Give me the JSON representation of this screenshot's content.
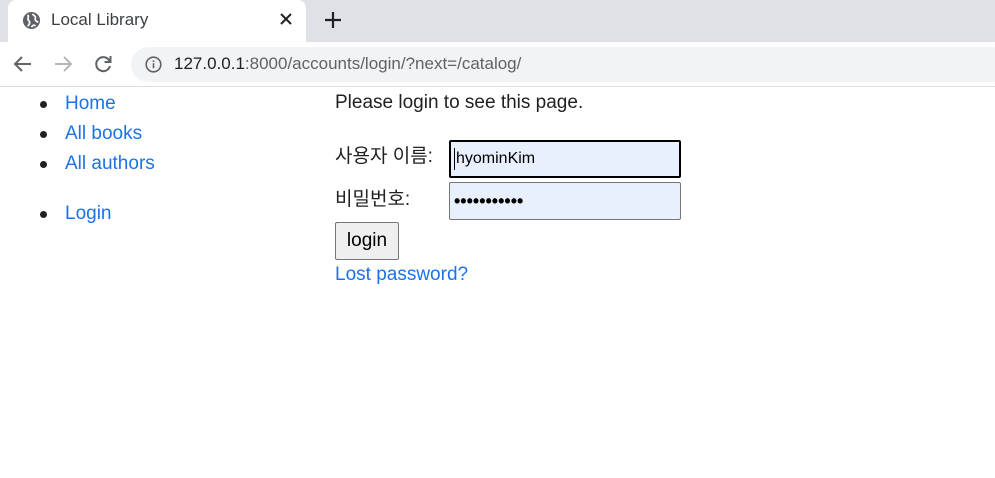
{
  "browser": {
    "tab_title": "Local Library",
    "url_host": "127.0.0.1",
    "url_path": ":8000/accounts/login/?next=/catalog/",
    "icons": {
      "favicon": "globe-icon",
      "close": "close-icon",
      "new_tab": "plus-icon",
      "back": "back-arrow-icon",
      "forward": "forward-arrow-icon",
      "reload": "reload-icon",
      "site_info": "info-icon"
    }
  },
  "sidebar": {
    "nav_links": [
      "Home",
      "All books",
      "All authors"
    ],
    "account_links": [
      "Login"
    ]
  },
  "login": {
    "notice": "Please login to see this page.",
    "username_label": "사용자 이름:",
    "username_value": "hyominKim",
    "password_label": "비밀번호:",
    "password_masked": "•••••••••••",
    "submit_label": "login",
    "lost_password": "Lost password?"
  },
  "colors": {
    "link": "#1a73e8",
    "autofill_bg": "#e8f0fe",
    "tabstrip": "#dee1e6",
    "omnibox": "#f1f3f4"
  }
}
